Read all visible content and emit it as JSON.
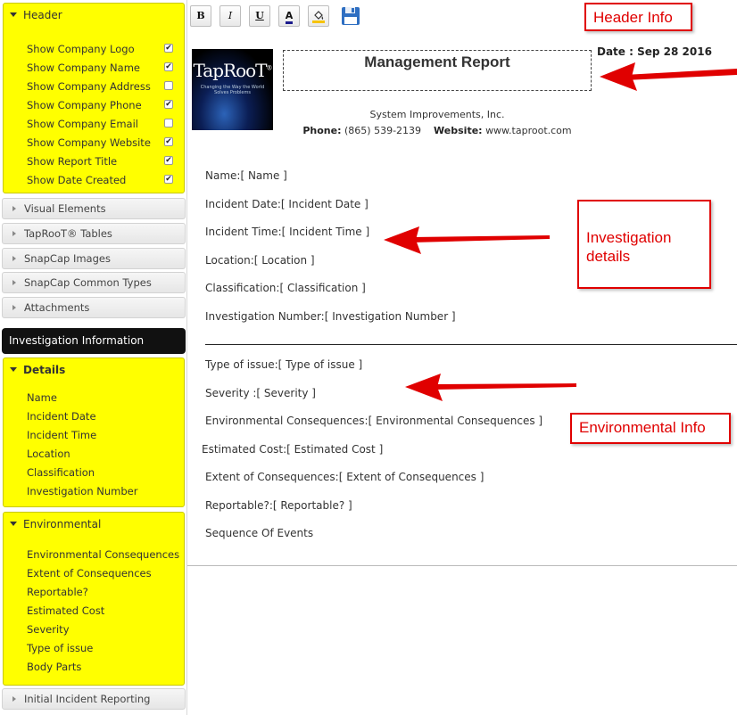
{
  "sidebar": {
    "header_panel": {
      "title": "Header",
      "options": [
        {
          "label": "Show Company Logo",
          "checked": true
        },
        {
          "label": "Show Company Name",
          "checked": true
        },
        {
          "label": "Show Company Address",
          "checked": false
        },
        {
          "label": "Show Company Phone",
          "checked": true
        },
        {
          "label": "Show Company Email",
          "checked": false
        },
        {
          "label": "Show Company Website",
          "checked": true
        },
        {
          "label": "Show Report Title",
          "checked": true
        },
        {
          "label": "Show Date Created",
          "checked": true
        }
      ]
    },
    "collapsed_top": [
      "Visual Elements",
      "TapRooT® Tables",
      "SnapCap Images",
      "SnapCap Common Types",
      "Attachments"
    ],
    "investigation_information": "Investigation Information",
    "details_panel": {
      "title": "Details",
      "fields": [
        "Name",
        "Incident Date",
        "Incident Time",
        "Location",
        "Classification",
        "Investigation Number"
      ]
    },
    "environmental_panel": {
      "title": "Environmental",
      "fields": [
        "Environmental Consequences",
        "Extent of Consequences",
        "Reportable?",
        "Estimated Cost",
        "Severity",
        "Type of issue",
        "Body Parts"
      ]
    },
    "collapsed_bottom": [
      "Initial Incident Reporting"
    ]
  },
  "toolbar": {
    "bold": "B",
    "italic": "I",
    "underline": "U",
    "font_color": "A"
  },
  "report": {
    "logo_text": "TapRooT",
    "logo_reg": "®",
    "logo_tagline": "Changing the Way the World Solves Problems",
    "title": "Management Report",
    "date_label": "Date : Sep 28 2016",
    "company_name": "System Improvements, Inc.",
    "phone_label": "Phone:",
    "phone": "(865) 539-2139",
    "website_label": "Website:",
    "website": "www.taproot.com",
    "investigation_lines": [
      "Name:[ Name ]",
      "Incident Date:[ Incident Date ]",
      "Incident Time:[ Incident Time ]",
      "Location:[ Location ]",
      "Classification:[ Classification ]",
      "Investigation Number:[ Investigation Number ]"
    ],
    "environmental_lines": [
      "Type of issue:[ Type of issue ]",
      "Severity :[ Severity ]",
      "Environmental Consequences:[ Environmental Consequences ]",
      "Estimated Cost:[ Estimated Cost ]",
      "Extent of Consequences:[ Extent of Consequences ]",
      "Reportable?:[ Reportable? ]",
      "Sequence Of Events"
    ]
  },
  "annotations": {
    "header_info": "Header Info",
    "investigation_details": "Investigation details",
    "environmental_info": "Environmental Info",
    "accent_color": "#e00000",
    "highlight_color": "#ffff00"
  }
}
